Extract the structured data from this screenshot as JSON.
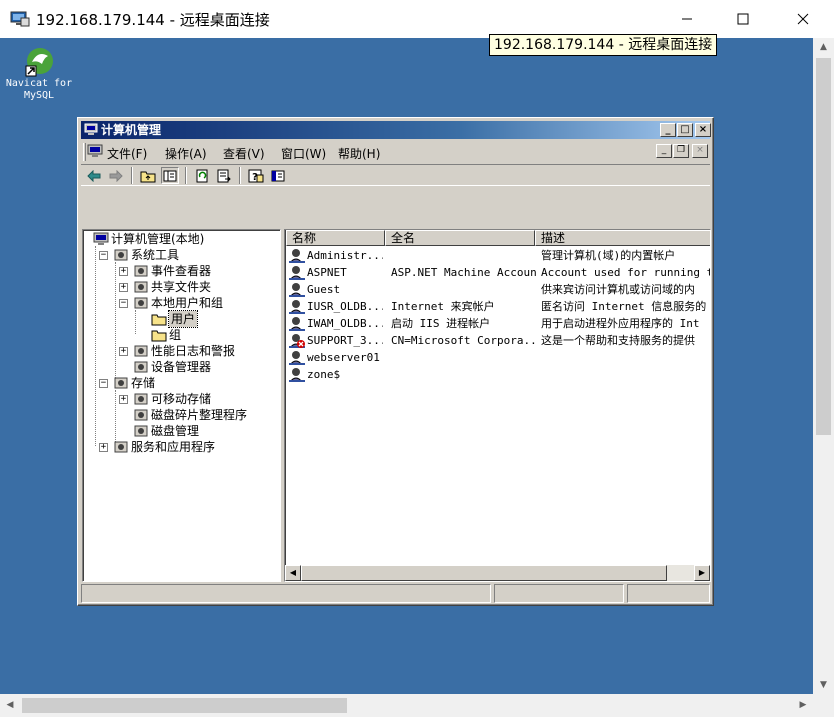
{
  "rdp": {
    "title": "192.168.179.144 - 远程桌面连接",
    "tooltip": "192.168.179.144 - 远程桌面连接",
    "minimize_icon": "minimize-icon",
    "maximize_icon": "maximize-icon",
    "close_icon": "close-icon"
  },
  "desktop": {
    "background": "#3a6ea5",
    "icons": [
      {
        "label_line1": "Navicat for",
        "label_line2": "MySQL",
        "icon": "navicat-dolphin-icon"
      }
    ]
  },
  "mmc": {
    "title": "计算机管理",
    "menu": [
      "文件(F)",
      "操作(A)",
      "查看(V)",
      "窗口(W)",
      "帮助(H)"
    ],
    "toolbar_icons": [
      "back-arrow-icon",
      "forward-arrow-icon",
      "up-folder-icon",
      "show-hide-tree-icon",
      "refresh-icon",
      "export-list-icon",
      "help-icon",
      "properties-icon"
    ],
    "tree": [
      {
        "label": "计算机管理(本地)",
        "level": 0,
        "icon": "computer-icon"
      },
      {
        "label": "系统工具",
        "level": 1,
        "icon": "tools-icon",
        "expander": "−"
      },
      {
        "label": "事件查看器",
        "level": 2,
        "icon": "event-viewer-icon",
        "expander": "+"
      },
      {
        "label": "共享文件夹",
        "level": 2,
        "icon": "shared-folder-icon",
        "expander": "+"
      },
      {
        "label": "本地用户和组",
        "level": 2,
        "icon": "users-groups-icon",
        "expander": "−"
      },
      {
        "label": "用户",
        "level": 3,
        "icon": "folder-icon",
        "selected": true
      },
      {
        "label": "组",
        "level": 3,
        "icon": "folder-icon"
      },
      {
        "label": "性能日志和警报",
        "level": 2,
        "icon": "performance-icon",
        "expander": "+"
      },
      {
        "label": "设备管理器",
        "level": 2,
        "icon": "device-manager-icon"
      },
      {
        "label": "存储",
        "level": 1,
        "icon": "storage-icon",
        "expander": "−"
      },
      {
        "label": "可移动存储",
        "level": 2,
        "icon": "removable-storage-icon",
        "expander": "+"
      },
      {
        "label": "磁盘碎片整理程序",
        "level": 2,
        "icon": "defrag-icon"
      },
      {
        "label": "磁盘管理",
        "level": 2,
        "icon": "disk-management-icon"
      },
      {
        "label": "服务和应用程序",
        "level": 1,
        "icon": "services-icon",
        "expander": "+"
      }
    ],
    "columns": [
      "名称",
      "全名",
      "描述"
    ],
    "users": [
      {
        "name": "Administr...",
        "fullname": "",
        "desc": "管理计算机(域)的内置帐户",
        "disabled": false
      },
      {
        "name": "ASPNET",
        "fullname": "ASP.NET Machine Account",
        "desc": "Account used for running the",
        "disabled": false
      },
      {
        "name": "Guest",
        "fullname": "",
        "desc": "供来宾访问计算机或访问域的内",
        "disabled": false
      },
      {
        "name": "IUSR_OLDB...",
        "fullname": "Internet 来宾帐户",
        "desc": "匿名访问 Internet 信息服务的",
        "disabled": false
      },
      {
        "name": "IWAM_OLDB...",
        "fullname": "启动 IIS 进程帐户",
        "desc": "用于启动进程外应用程序的 Int",
        "disabled": false
      },
      {
        "name": "SUPPORT_3...",
        "fullname": "CN=Microsoft Corpora...",
        "desc": "这是一个帮助和支持服务的提供",
        "disabled": true
      },
      {
        "name": "webserver01",
        "fullname": "",
        "desc": "",
        "disabled": false
      },
      {
        "name": "zone$",
        "fullname": "",
        "desc": "",
        "disabled": false
      }
    ]
  }
}
